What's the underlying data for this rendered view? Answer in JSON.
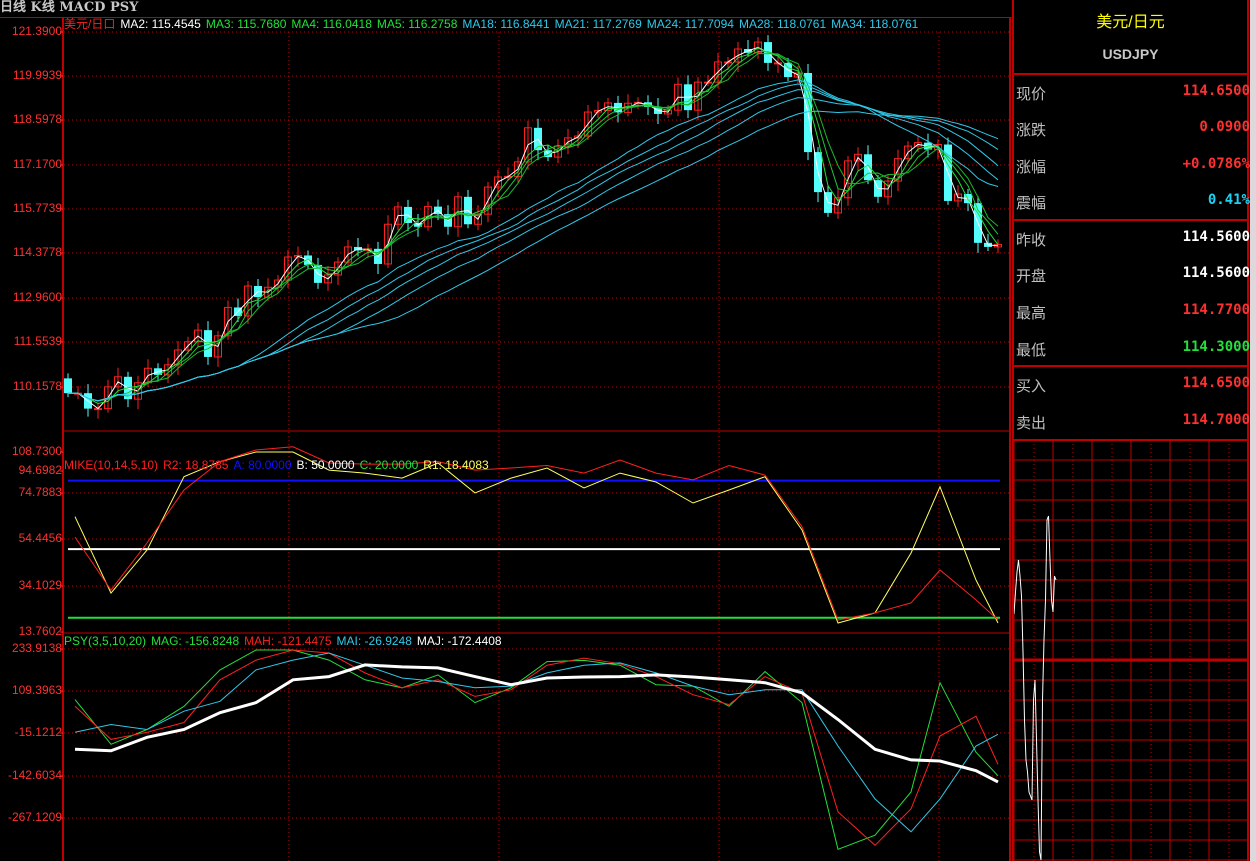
{
  "header": {
    "title": "日线 K线 MACD PSY"
  },
  "main_panel": {
    "symbol_label": "美元/日口",
    "ma_legend": [
      {
        "label": "MA2: 115.4545",
        "color": "#ffffff"
      },
      {
        "label": "MA3: 115.7680",
        "color": "#22e03a"
      },
      {
        "label": "MA4: 116.0418",
        "color": "#22e03a"
      },
      {
        "label": "MA5: 116.2758",
        "color": "#22e03a"
      },
      {
        "label": "MA18: 116.8441",
        "color": "#30c8e8"
      },
      {
        "label": "MA21: 117.2769",
        "color": "#30c8e8"
      },
      {
        "label": "MA24: 117.7094",
        "color": "#30c8e8"
      },
      {
        "label": "MA28: 118.0761",
        "color": "#30c8e8"
      },
      {
        "label": "MA34: 118.0761",
        "color": "#30c8e8"
      }
    ],
    "axis_ticks": [
      "121.3900",
      "119.9939",
      "118.5978",
      "117.1700",
      "115.7739",
      "114.3778",
      "112.9600",
      "111.5539",
      "110.1578",
      "108.7300"
    ]
  },
  "mike_panel": {
    "legend": [
      {
        "label": "MIKE(10,14,5,10)",
        "color": "#ff2020"
      },
      {
        "label": "R2: 18.8785",
        "color": "#ff2020"
      },
      {
        "label": "A: 80.0000",
        "color": "#1010ff"
      },
      {
        "label": "B: 50.0000",
        "color": "#ffffff"
      },
      {
        "label": "C: 20.0000",
        "color": "#22e03a"
      },
      {
        "label": "R1: 18.4083",
        "color": "#ffff60"
      }
    ],
    "axis_ticks": [
      "94.6982",
      "74.7883",
      "54.4456",
      "34.1029",
      "13.7602"
    ]
  },
  "psy_panel": {
    "legend": [
      {
        "label": "PSY(3,5,10,20)",
        "color": "#22e03a"
      },
      {
        "label": "MAG: -156.8248",
        "color": "#22e03a"
      },
      {
        "label": "MAH: -121.4475",
        "color": "#ff2020"
      },
      {
        "label": "MAI: -26.9248",
        "color": "#30c8e8"
      },
      {
        "label": "MAJ: -172.4408",
        "color": "#ffffff"
      }
    ],
    "axis_ticks": [
      "233.9138",
      "109.3963",
      "-15.1212",
      "-142.6034",
      "-267.1209"
    ]
  },
  "quote": {
    "name": "美元/日元",
    "code": "USDJPY",
    "rows": [
      {
        "label": "现价",
        "value": "114.6500",
        "color": "#ff3030"
      },
      {
        "label": "涨跌",
        "value": "0.0900",
        "color": "#ff3030"
      },
      {
        "label": "涨幅",
        "value": "+0.0786%",
        "color": "#ff3030"
      },
      {
        "label": "震幅",
        "value": "0.41%",
        "color": "#20d0f0"
      },
      {
        "label": "昨收",
        "value": "114.5600",
        "color": "#ffffff"
      },
      {
        "label": "开盘",
        "value": "114.5600",
        "color": "#ffffff"
      },
      {
        "label": "最高",
        "value": "114.7700",
        "color": "#ff3030"
      },
      {
        "label": "最低",
        "value": "114.3000",
        "color": "#22e03a"
      },
      {
        "label": "买入",
        "value": "114.6500",
        "color": "#ff3030"
      },
      {
        "label": "卖出",
        "value": "114.7000",
        "color": "#ff3030"
      }
    ]
  },
  "colors": {
    "up": "#ff2020",
    "down": "#54fcfc",
    "grid": "#c00000"
  },
  "chart_data": [
    {
      "type": "candlestick",
      "title": "USDJPY 日线",
      "ylim": [
        108.73,
        121.39
      ],
      "close": [
        109.93,
        109.93,
        109.44,
        109.44,
        110.13,
        110.45,
        109.74,
        110.26,
        110.72,
        110.51,
        110.83,
        111.3,
        111.56,
        111.93,
        111.08,
        111.75,
        112.65,
        112.38,
        113.33,
        112.98,
        113.29,
        113.52,
        114.25,
        114.3,
        114.0,
        113.43,
        113.68,
        114.09,
        114.57,
        114.46,
        114.51,
        114.03,
        115.29,
        115.84,
        115.33,
        115.21,
        115.85,
        115.61,
        115.21,
        116.16,
        115.29,
        115.61,
        116.47,
        116.79,
        116.81,
        117.27,
        118.35,
        117.64,
        117.42,
        117.77,
        118.03,
        118.09,
        118.85,
        118.9,
        119.14,
        118.84,
        119.13,
        119.16,
        119.01,
        118.79,
        118.91,
        119.73,
        118.91,
        119.8,
        119.8,
        120.44,
        120.44,
        120.85,
        120.73,
        121.07,
        120.41,
        120.41,
        119.96,
        120.09,
        117.58,
        116.31,
        115.65,
        116.13,
        117.3,
        117.51,
        116.69,
        116.16,
        116.66,
        117.37,
        117.77,
        117.88,
        117.66,
        117.82,
        116.03,
        116.25,
        115.96,
        114.7,
        114.57,
        114.65
      ],
      "first_open": 110.4,
      "moving_averages": [
        2,
        3,
        4,
        5,
        18,
        21,
        24,
        28,
        34
      ]
    },
    {
      "type": "line",
      "title": "MIKE(10,14,5,10)",
      "ylim": [
        13.7602,
        94.6982
      ],
      "x": [
        0.7,
        4.3,
        7.9,
        11.6,
        15.2,
        18.8,
        22.5,
        26.1,
        29.7,
        33.4,
        37,
        40.7,
        44.3,
        47.9,
        51.6,
        55.2,
        58.8,
        62.5,
        66.1,
        69.7,
        73.4,
        77,
        80.7,
        84.3,
        87.2,
        90.8,
        93
      ],
      "series": [
        {
          "name": "R1",
          "color": "#ffff60",
          "values": [
            64.2,
            30.8,
            49.6,
            81.7,
            88.3,
            92.5,
            92.5,
            84.6,
            83.3,
            81.1,
            87.7,
            74.6,
            81.1,
            85.5,
            76.8,
            83.3,
            79.4,
            70.2,
            75.9,
            81.7,
            58.4,
            17.7,
            22.1,
            48.3,
            77.3,
            36.5,
            17.7
          ]
        },
        {
          "name": "R2",
          "color": "#ff2020",
          "values": [
            55.3,
            32.1,
            52.7,
            75.9,
            88.3,
            93.4,
            94.8,
            87.7,
            87.2,
            87.2,
            88.3,
            84.6,
            85.5,
            86.6,
            83.3,
            89.0,
            83.3,
            80.3,
            86.6,
            82.4,
            59.8,
            19.0,
            22.1,
            26.5,
            40.9,
            27.8,
            19.0
          ]
        }
      ],
      "levels": [
        {
          "name": "A",
          "value": 80,
          "color": "#1010ff"
        },
        {
          "name": "B",
          "value": 50,
          "color": "#ffffff"
        },
        {
          "name": "C",
          "value": 20,
          "color": "#22e03a"
        }
      ]
    },
    {
      "type": "line",
      "title": "PSY(3,5,10,20)",
      "ylim": [
        -267.1209,
        233.9138
      ],
      "x": [
        0.7,
        4.3,
        7.9,
        11.6,
        15.2,
        18.8,
        22.5,
        26.1,
        29.7,
        33.4,
        37,
        40.7,
        44.3,
        47.9,
        51.6,
        55.2,
        58.8,
        62.5,
        66.1,
        69.7,
        73.4,
        77,
        80.7,
        84.3,
        87.2,
        90.8,
        93
      ],
      "series": [
        {
          "name": "MAG",
          "color": "#22e03a",
          "values": [
            83.8,
            -48.7,
            -4.6,
            64,
            172,
            231,
            231,
            201,
            142.7,
            119,
            157,
            75,
            119,
            196.6,
            200,
            186,
            128,
            124,
            64,
            167,
            75,
            -360,
            -318,
            -190,
            134,
            -72,
            -142
          ]
        },
        {
          "name": "MAH",
          "color": "#ff2020",
          "values": [
            64,
            -34,
            -13,
            16,
            142.7,
            201,
            231,
            222,
            163,
            119,
            142.7,
            93.5,
            113,
            186,
            207,
            190,
            152,
            98.5,
            69,
            152,
            103,
            -249,
            -348,
            -240,
            -24,
            34.6,
            -108
          ]
        },
        {
          "name": "MAI",
          "color": "#30c8e8",
          "values": [
            -13,
            10,
            -4.6,
            49.4,
            79,
            172,
            201,
            222,
            186,
            148,
            137.6,
            119,
            124,
            163,
            186,
            192.7,
            163,
            124,
            98.5,
            113,
            113,
            -53.7,
            -210.6,
            -308,
            -210.6,
            -53.7,
            -19
          ]
        },
        {
          "name": "MAJ",
          "color": "#ffffff",
          "values": [
            -63.4,
            -68,
            -28,
            -4.6,
            45,
            75,
            142.7,
            152,
            186.8,
            180.9,
            178,
            152,
            128,
            148,
            151,
            152,
            157,
            151,
            142.7,
            134,
            104,
            25,
            -63.4,
            -95,
            -98,
            -127,
            -160
          ]
        }
      ]
    },
    {
      "type": "line",
      "title": "intraday",
      "reference": 114.56,
      "values": [
        114.675,
        114.73,
        114.78,
        114.81,
        114.77,
        114.72,
        114.58,
        114.41,
        114.31,
        114.28,
        114.23,
        114.22,
        114.21,
        114.46,
        114.51,
        114.36,
        114.21,
        114.08,
        114.06,
        114.46,
        114.61,
        114.71,
        114.91,
        114.92,
        114.81,
        114.71,
        114.68,
        114.77,
        114.76
      ]
    }
  ]
}
